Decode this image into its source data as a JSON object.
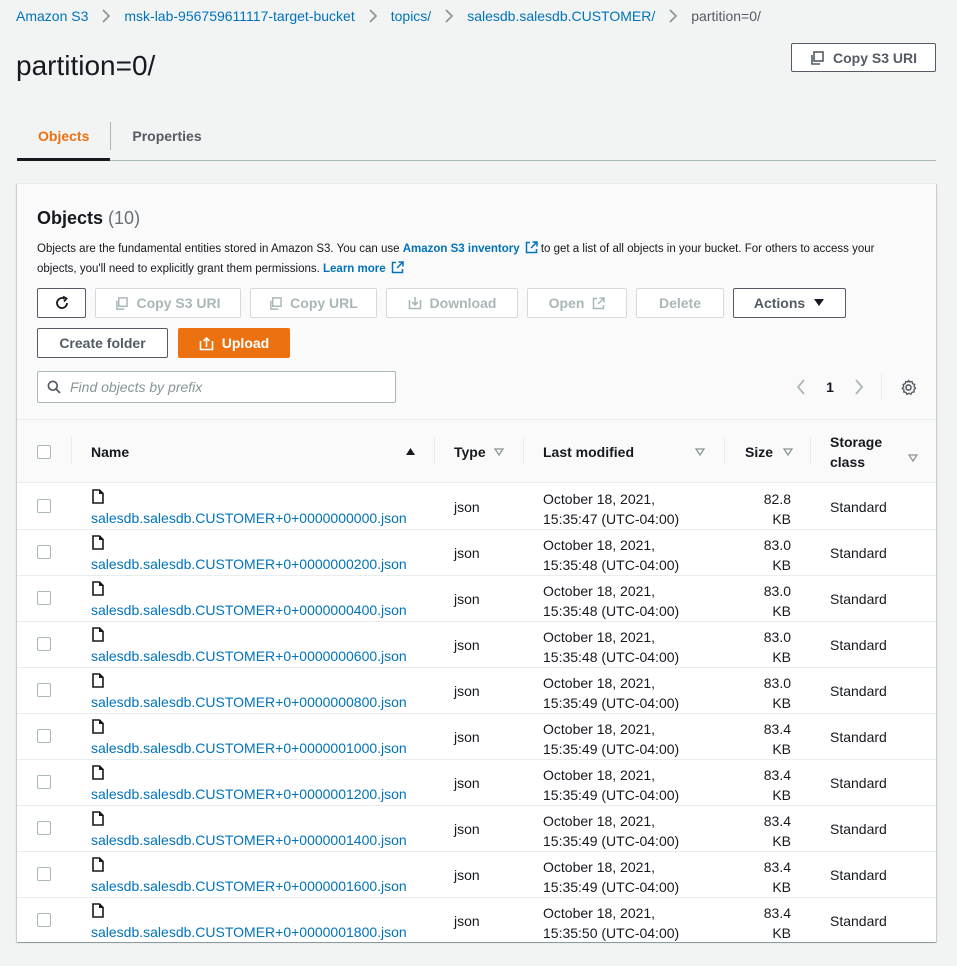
{
  "breadcrumb": [
    {
      "label": "Amazon S3"
    },
    {
      "label": "msk-lab-956759611117-target-bucket"
    },
    {
      "label": "topics/"
    },
    {
      "label": "salesdb.salesdb.CUSTOMER/"
    },
    {
      "label": "partition=0/"
    }
  ],
  "page": {
    "title": "partition=0/",
    "copy_uri_label": "Copy S3 URI"
  },
  "tabs": [
    {
      "label": "Objects",
      "active": true
    },
    {
      "label": "Properties",
      "active": false
    }
  ],
  "objects_panel": {
    "title": "Objects",
    "count": "(10)",
    "desc_part1": "Objects are the fundamental entities stored in Amazon S3. You can use",
    "desc_link1": "Amazon S3 inventory",
    "desc_part2": "to get a list of all objects in your bucket. For others to access your objects, you'll need to explicitly grant them permissions.",
    "desc_link2": "Learn more",
    "toolbar": {
      "copy_uri": "Copy S3 URI",
      "copy_url": "Copy URL",
      "download": "Download",
      "open": "Open",
      "delete": "Delete",
      "actions": "Actions",
      "create_folder": "Create folder",
      "upload": "Upload"
    },
    "search_placeholder": "Find objects by prefix",
    "current_page": "1"
  },
  "table": {
    "columns": {
      "name": "Name",
      "type": "Type",
      "modified": "Last modified",
      "size": "Size",
      "storage": "Storage",
      "storage2": "class"
    },
    "rows": [
      {
        "name": "salesdb.salesdb.CUSTOMER+0+0000000000.json",
        "type": "json",
        "date1": "October 18, 2021,",
        "date2": "15:35:47 (UTC-04:00)",
        "size1": "82.8",
        "size2": "KB",
        "storage": "Standard"
      },
      {
        "name": "salesdb.salesdb.CUSTOMER+0+0000000200.json",
        "type": "json",
        "date1": "October 18, 2021,",
        "date2": "15:35:48 (UTC-04:00)",
        "size1": "83.0",
        "size2": "KB",
        "storage": "Standard"
      },
      {
        "name": "salesdb.salesdb.CUSTOMER+0+0000000400.json",
        "type": "json",
        "date1": "October 18, 2021,",
        "date2": "15:35:48 (UTC-04:00)",
        "size1": "83.0",
        "size2": "KB",
        "storage": "Standard"
      },
      {
        "name": "salesdb.salesdb.CUSTOMER+0+0000000600.json",
        "type": "json",
        "date1": "October 18, 2021,",
        "date2": "15:35:48 (UTC-04:00)",
        "size1": "83.0",
        "size2": "KB",
        "storage": "Standard"
      },
      {
        "name": "salesdb.salesdb.CUSTOMER+0+0000000800.json",
        "type": "json",
        "date1": "October 18, 2021,",
        "date2": "15:35:49 (UTC-04:00)",
        "size1": "83.0",
        "size2": "KB",
        "storage": "Standard"
      },
      {
        "name": "salesdb.salesdb.CUSTOMER+0+0000001000.json",
        "type": "json",
        "date1": "October 18, 2021,",
        "date2": "15:35:49 (UTC-04:00)",
        "size1": "83.4",
        "size2": "KB",
        "storage": "Standard"
      },
      {
        "name": "salesdb.salesdb.CUSTOMER+0+0000001200.json",
        "type": "json",
        "date1": "October 18, 2021,",
        "date2": "15:35:49 (UTC-04:00)",
        "size1": "83.4",
        "size2": "KB",
        "storage": "Standard"
      },
      {
        "name": "salesdb.salesdb.CUSTOMER+0+0000001400.json",
        "type": "json",
        "date1": "October 18, 2021,",
        "date2": "15:35:49 (UTC-04:00)",
        "size1": "83.4",
        "size2": "KB",
        "storage": "Standard"
      },
      {
        "name": "salesdb.salesdb.CUSTOMER+0+0000001600.json",
        "type": "json",
        "date1": "October 18, 2021,",
        "date2": "15:35:49 (UTC-04:00)",
        "size1": "83.4",
        "size2": "KB",
        "storage": "Standard"
      },
      {
        "name": "salesdb.salesdb.CUSTOMER+0+0000001800.json",
        "type": "json",
        "date1": "October 18, 2021,",
        "date2": "15:35:50 (UTC-04:00)",
        "size1": "83.4",
        "size2": "KB",
        "storage": "Standard"
      }
    ]
  },
  "colors": {
    "link": "#0073bb",
    "accent": "#ec7211",
    "text": "#16191f",
    "muted": "#545b64",
    "disabled": "#aab7b8",
    "background": "#f2f3f3"
  },
  "icons": [
    "chevron-right-icon",
    "copy-icon",
    "refresh-icon",
    "download-icon",
    "external-link-icon",
    "caret-down-icon",
    "upload-icon",
    "search-icon",
    "chevron-left-icon",
    "gear-icon",
    "sort-asc-icon",
    "sort-caret-icon",
    "file-icon"
  ]
}
